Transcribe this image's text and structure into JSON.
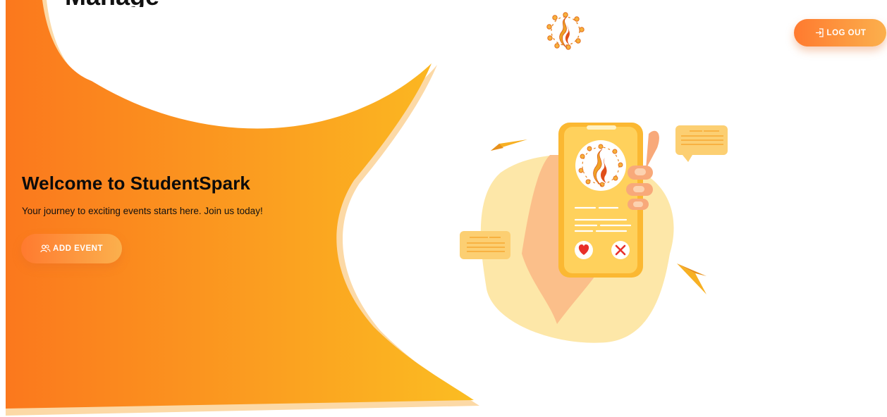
{
  "header": {
    "cutoff_title": "Manage your page",
    "logout_label": "LOG OUT"
  },
  "hero": {
    "title": "Welcome to StudentSpark",
    "subtitle": "Your journey to exciting events starts here. Join us today!",
    "add_event_label": "ADD EVENT"
  },
  "icons": {
    "logo": "studentspark-flame-logo",
    "logout": "login-arrow-icon",
    "add_event": "users-icon"
  },
  "colors": {
    "accent_start": "#ff7a2f",
    "accent_end": "#fbb04d",
    "blob_start": "#fb7a1e",
    "blob_end": "#fbb920",
    "blob_shadow": "#fcd9a6"
  }
}
